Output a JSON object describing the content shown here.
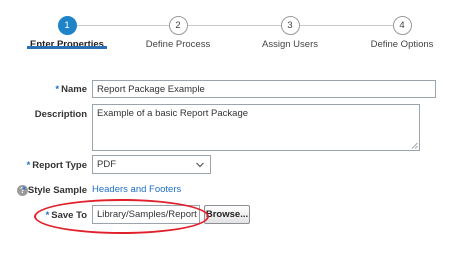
{
  "wizard": {
    "steps": [
      {
        "number": "1",
        "label": "Enter Properties"
      },
      {
        "number": "2",
        "label": "Define Process"
      },
      {
        "number": "3",
        "label": "Assign Users"
      },
      {
        "number": "4",
        "label": "Define Options"
      }
    ],
    "active_step": 1
  },
  "form": {
    "required_marker": "*",
    "name": {
      "label": "Name",
      "value": "Report Package Example"
    },
    "description": {
      "label": "Description",
      "value": "Example of a basic Report Package"
    },
    "report_type": {
      "label": "Report Type",
      "value": "PDF"
    },
    "style_sample": {
      "label": "Style Sample",
      "link": "Headers and Footers",
      "help_icon_text": "?"
    },
    "save_to": {
      "label": "Save To",
      "value": "Library/Samples/Report Pac",
      "browse_label": "Browse..."
    }
  },
  "colors": {
    "accent": "#1f84c7",
    "required_marker": "#1f6fc4",
    "link": "#1f6fc4",
    "highlight_ring": "#e0202a"
  },
  "icons": [
    "chevron-down-icon",
    "help-icon",
    "resize-grip-icon"
  ]
}
